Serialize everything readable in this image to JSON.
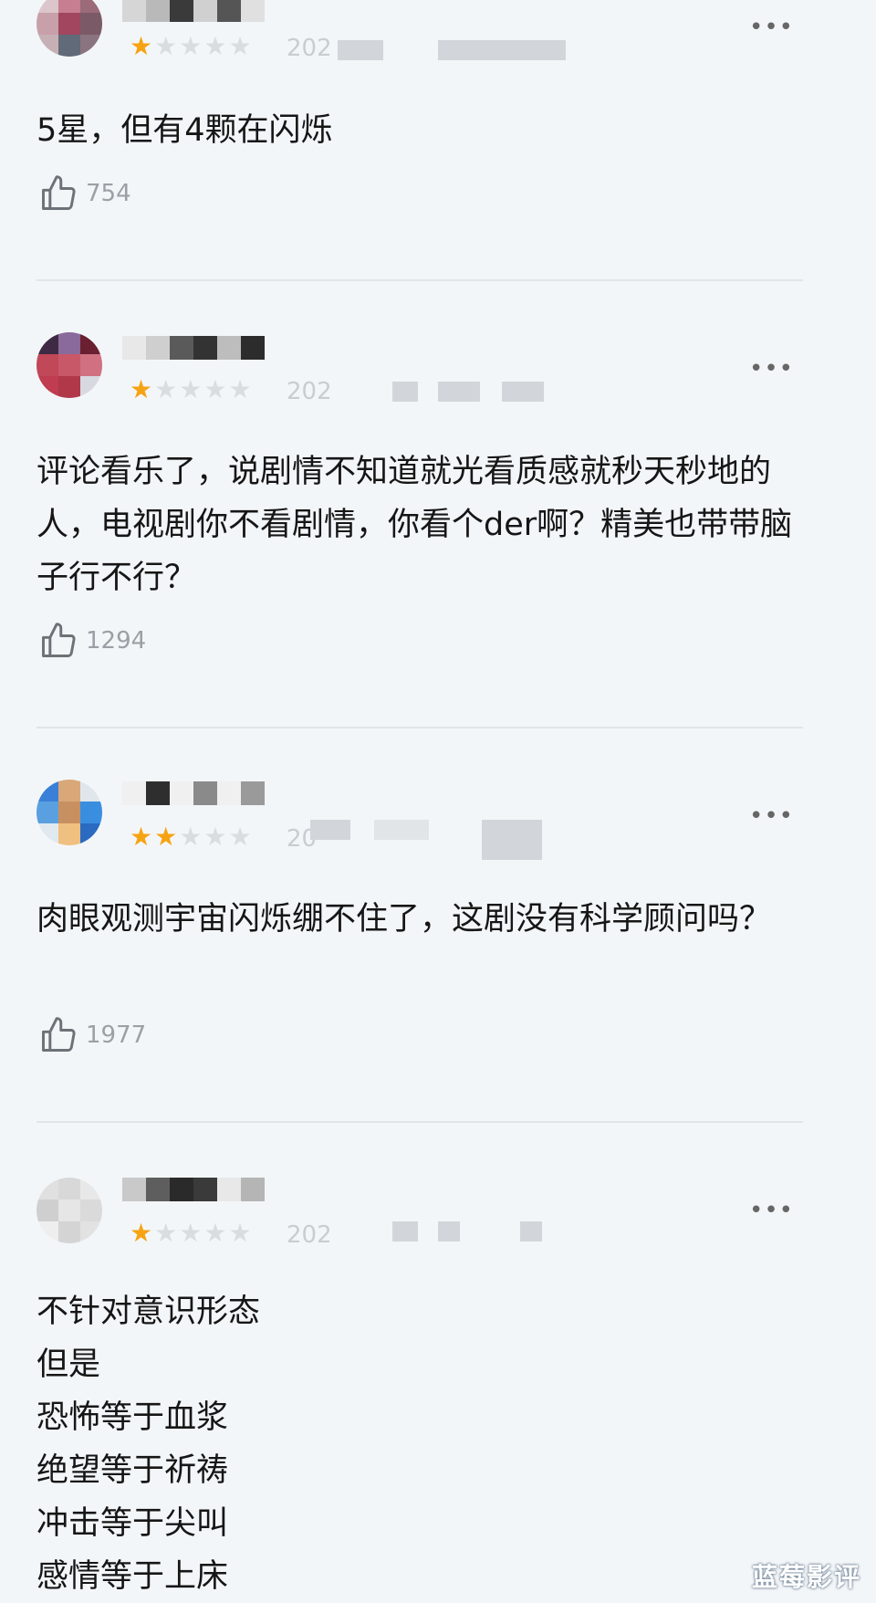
{
  "reviews": [
    {
      "avatar": [
        "#dcc6cc",
        "#c77e90",
        "#9b6b7a",
        "#c8a0aa",
        "#a0465e",
        "#7a5a66",
        "#c6b0b6",
        "#606a78",
        "#8a7480"
      ],
      "username_blocks": [
        "#d6d6d6",
        "#b9b9b9",
        "#3a3a3a",
        "#d0d0d0",
        "#555555",
        "#e0e0e0"
      ],
      "rating": 1,
      "date_prefix": "202",
      "content": "5星，但有4颗在闪烁",
      "likes": "754"
    },
    {
      "avatar": [
        "#3e2a44",
        "#8a6a9a",
        "#6a2030",
        "#c04858",
        "#c85868",
        "#d07080",
        "#c03c50",
        "#b03848",
        "#d8d8e0"
      ],
      "username_blocks": [
        "#e8e8e8",
        "#cfcfcf",
        "#5a5a5a",
        "#333333",
        "#bdbdbd",
        "#2c2c2c"
      ],
      "rating": 1,
      "date_prefix": "202",
      "content": "评论看乐了，说剧情不知道就光看质感就秒天秒地的人，电视剧你不看剧情，你看个der啊？精美也带带脑子行不行？",
      "likes": "1294"
    },
    {
      "avatar": [
        "#3a7fd8",
        "#d8a878",
        "#e0e6ec",
        "#5aa0e0",
        "#c89060",
        "#3a8ee0",
        "#e0e8f0",
        "#f0c080",
        "#2a6ac0"
      ],
      "username_blocks": [
        "#f0f0f0",
        "#2e2e2e",
        "#f0f0f0",
        "#8a8a8a",
        "#f0f0f0",
        "#9a9a9a"
      ],
      "rating": 2,
      "date_prefix": "20",
      "content": "肉眼观测宇宙闪烁绷不住了，这剧没有科学顾问吗？",
      "likes": "1977"
    },
    {
      "avatar": [
        "#e0e0e0",
        "#d8d8d8",
        "#e8e8e8",
        "#cfcfcf",
        "#e6e6e6",
        "#dadada",
        "#eeeeee",
        "#d4d4d4",
        "#e2e2e2"
      ],
      "username_blocks": [
        "#c9c9c9",
        "#5e5e5e",
        "#2a2a2a",
        "#3a3a3a",
        "#e8e8e8",
        "#b5b5b5"
      ],
      "rating": 1,
      "date_prefix": "202",
      "content": "不针对意识形态\n但是\n恐怖等于血浆\n绝望等于祈祷\n冲击等于尖叫\n感情等于上床",
      "likes": ""
    }
  ],
  "more_label": "•••",
  "watermark": "蓝莓影评",
  "colors": {
    "star_on": "#f6a313",
    "star_off": "#d9dde1",
    "background": "#f3f6f8",
    "divider": "#e1e5e8"
  }
}
